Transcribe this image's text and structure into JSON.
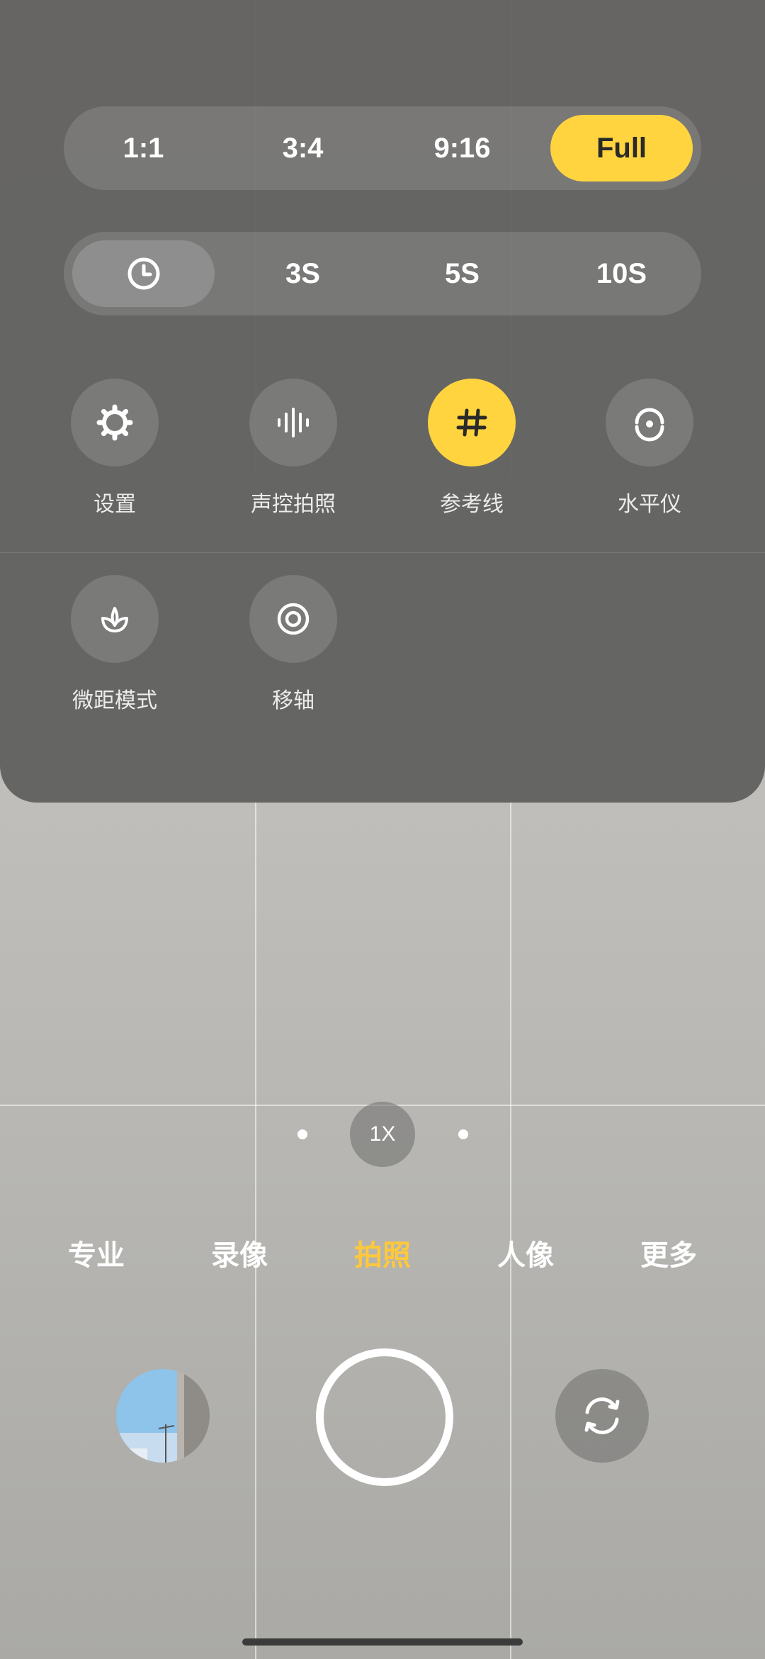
{
  "aspect_ratio": {
    "options": [
      "1:1",
      "3:4",
      "9:16",
      "Full"
    ],
    "selected": "Full"
  },
  "timer": {
    "icon": "clock-icon",
    "options": [
      "3S",
      "5S",
      "10S"
    ],
    "selected": "off"
  },
  "tools": [
    {
      "label": "设置",
      "icon": "gear-icon",
      "active": false
    },
    {
      "label": "声控拍照",
      "icon": "soundwave-icon",
      "active": false
    },
    {
      "label": "参考线",
      "icon": "grid-hash-icon",
      "active": true
    },
    {
      "label": "水平仪",
      "icon": "level-icon",
      "active": false
    },
    {
      "label": "微距模式",
      "icon": "flower-icon",
      "active": false
    },
    {
      "label": "移轴",
      "icon": "tilt-shift-icon",
      "active": false
    }
  ],
  "zoom": {
    "label": "1X"
  },
  "modes": {
    "items": [
      "专业",
      "录像",
      "拍照",
      "人像",
      "更多"
    ],
    "selected": "拍照"
  },
  "colors": {
    "accent_yellow": "#ffd43f",
    "active_mode": "#ffc93a",
    "panel": "#626260"
  },
  "icons": {
    "shutter": "shutter-button",
    "gallery": "gallery-thumbnail",
    "flip": "switch-camera-icon"
  }
}
